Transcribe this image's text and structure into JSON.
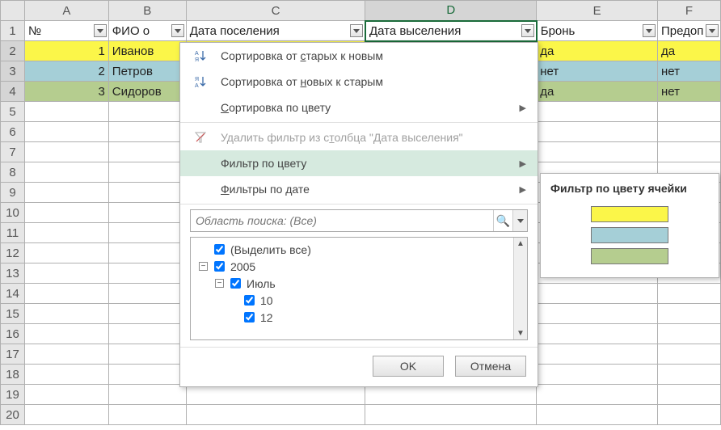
{
  "columns": {
    "letters": [
      "A",
      "B",
      "C",
      "D",
      "E",
      "F"
    ],
    "active": "D",
    "headers": {
      "A": "№",
      "B": "ФИО о",
      "C": "Дата поселения",
      "D": "Дата выселения",
      "E": "Бронь",
      "F": "Предоп"
    }
  },
  "row_numbers": [
    "1",
    "2",
    "3",
    "4",
    "5",
    "6",
    "7",
    "8",
    "9",
    "10",
    "11",
    "12",
    "13",
    "14",
    "15",
    "16",
    "17",
    "18",
    "19",
    "20"
  ],
  "rows": [
    {
      "n": "1",
      "name": "Иванов",
      "e": "да",
      "f": "да",
      "color": "yellow"
    },
    {
      "n": "2",
      "name": "Петров",
      "e": "нет",
      "f": "нет",
      "color": "blue"
    },
    {
      "n": "3",
      "name": "Сидоров",
      "e": "да",
      "f": "нет",
      "color": "green"
    }
  ],
  "dropdown": {
    "sort_asc": "Сортировка от старых к новым",
    "sort_desc": "Сортировка от новых к старым",
    "sort_color": "Сортировка по цвету",
    "clear_filter": "Удалить фильтр из столбца \"Дата выселения\"",
    "filter_color": "Фильтр по цвету",
    "filter_date": "Фильтры по дате",
    "search_placeholder": "Область поиска: (Все)",
    "tree": {
      "select_all": "(Выделить все)",
      "year": "2005",
      "month": "Июль",
      "days": [
        "10",
        "12"
      ]
    },
    "ok": "OK",
    "cancel": "Отмена",
    "underline": {
      "sort_asc_head": "Сортировка от ",
      "sort_asc_u": "с",
      "sort_asc_tail": "тарых к новым",
      "sort_desc_head": "Сортировка от ",
      "sort_desc_u": "н",
      "sort_desc_tail": "овых к старым",
      "sort_color_head": "",
      "sort_color_u": "С",
      "sort_color_tail": "ортировка по цвету",
      "clear_head": "Удалить фильтр из с",
      "clear_u": "т",
      "clear_tail": "олбца \"Дата выселения\"",
      "filter_date_head": "",
      "filter_date_u": "Ф",
      "filter_date_tail": "ильтры по дате"
    }
  },
  "submenu": {
    "title": "Фильтр по цвету ячейки",
    "colors": [
      "yellow",
      "blue",
      "green"
    ]
  }
}
